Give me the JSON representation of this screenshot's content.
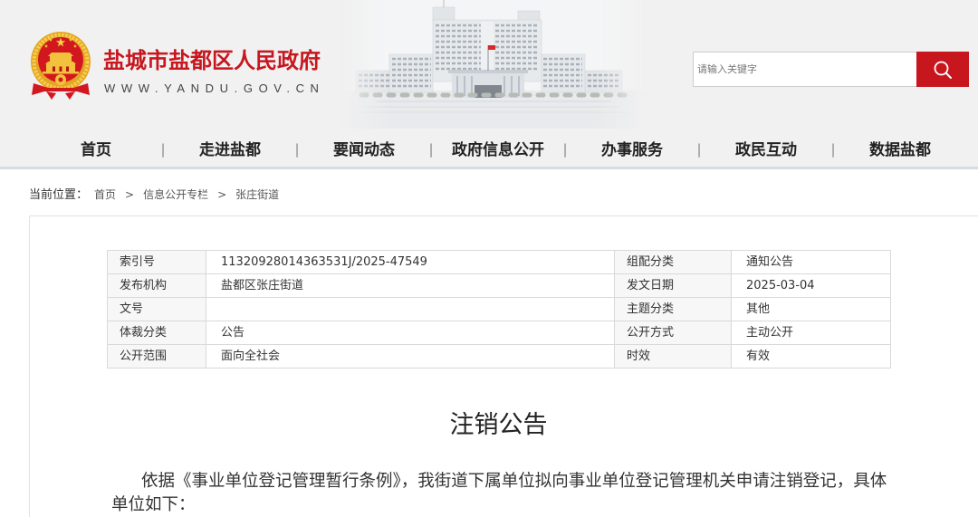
{
  "site": {
    "title": "盐城市盐都区人民政府",
    "domain": "WWW.YANDU.GOV.CN"
  },
  "search": {
    "placeholder": "请输入关键字"
  },
  "nav": {
    "separator": "|",
    "items": [
      "首页",
      "走进盐都",
      "要闻动态",
      "政府信息公开",
      "办事服务",
      "政民互动",
      "数据盐都"
    ]
  },
  "breadcrumb": {
    "label": "当前位置：",
    "separator": ">",
    "items": [
      "首页",
      "信息公开专栏",
      "张庄街道"
    ]
  },
  "meta_table": {
    "rows": [
      [
        {
          "label": "索引号",
          "value": "11320928014363531J/2025-47549"
        },
        {
          "label": "组配分类",
          "value": "通知公告"
        }
      ],
      [
        {
          "label": "发布机构",
          "value": "盐都区张庄街道"
        },
        {
          "label": "发文日期",
          "value": "2025-03-04"
        }
      ],
      [
        {
          "label": "文号",
          "value": ""
        },
        {
          "label": "主题分类",
          "value": "其他"
        }
      ],
      [
        {
          "label": "体裁分类",
          "value": "公告"
        },
        {
          "label": "公开方式",
          "value": "主动公开"
        }
      ],
      [
        {
          "label": "公开范围",
          "value": "面向全社会"
        },
        {
          "label": "时效",
          "value": "有效"
        }
      ]
    ]
  },
  "article": {
    "title": "注销公告",
    "paragraphs": [
      "依据《事业单位登记管理暂行条例》，我街道下属单位拟向事业单位登记管理机关申请注销登记，具体单位如下："
    ]
  },
  "colors": {
    "brand_red": "#c7161e",
    "nav_underline": "#d4dce5"
  },
  "icons": {
    "emblem": "national-emblem-icon",
    "search": "search-icon"
  }
}
